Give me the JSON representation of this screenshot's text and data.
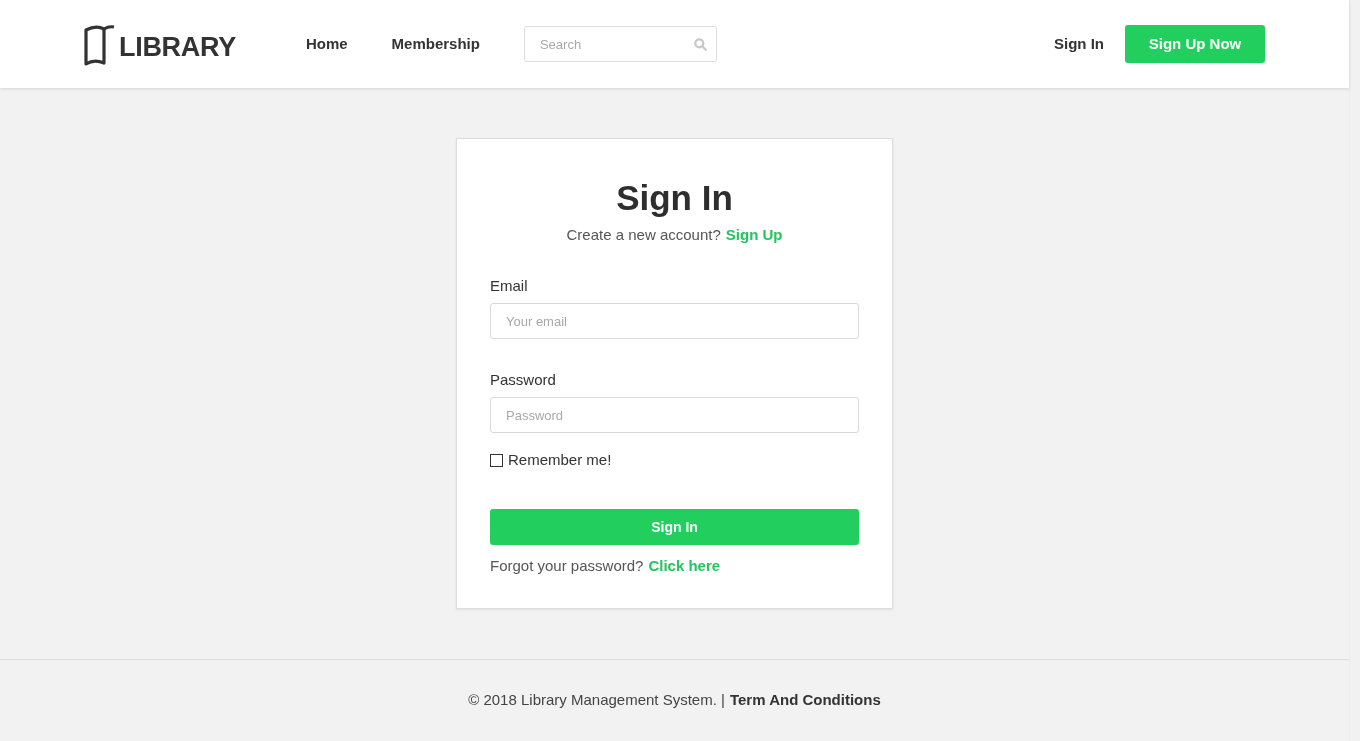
{
  "header": {
    "logo": "LIBRARY",
    "nav": [
      {
        "label": "Home"
      },
      {
        "label": "Membership"
      }
    ],
    "search": {
      "placeholder": "Search"
    },
    "sign_in": "Sign In",
    "sign_up": "Sign Up Now"
  },
  "form": {
    "title": "Sign In",
    "prompt": "Create a new account?",
    "prompt_link": "Sign Up",
    "fields": [
      {
        "label": "Email",
        "placeholder": "Your email"
      },
      {
        "label": "Password",
        "placeholder": "Password"
      }
    ],
    "remember": {
      "label": "Remember me!",
      "checked": false
    },
    "submit": "Sign In",
    "forgot": "Forgot your password?",
    "forgot_link": "Click here"
  },
  "footer": {
    "text": "© 2018 Library Management System. |",
    "link": "Term And Conditions"
  }
}
